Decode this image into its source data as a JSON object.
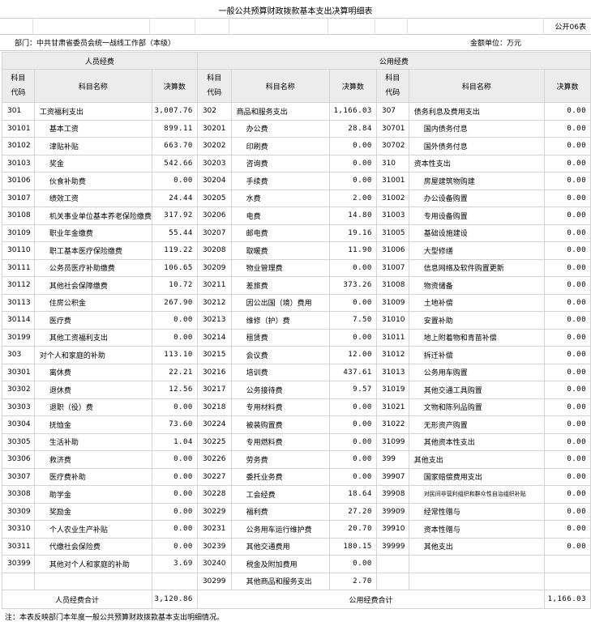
{
  "title": "一般公共预算财政拨款基本支出决算明细表",
  "form_code": "公开06表",
  "department": "部门：中共甘肃省委员会统一战线工作部（本级）",
  "unit": "金额单位：万元",
  "headers": {
    "personnel": "人员经费",
    "public": "公用经费",
    "code": "科目代码",
    "name": "科目名称",
    "amount": "决算数"
  },
  "rows": [
    [
      [
        "301",
        "工资福利支出",
        "3,007.76"
      ],
      [
        "302",
        "商品和服务支出",
        "1,166.03"
      ],
      [
        "307",
        "债务利息及费用支出",
        "0.00"
      ]
    ],
    [
      [
        "30101",
        "基本工资",
        "899.11"
      ],
      [
        "30201",
        "办公费",
        "28.84"
      ],
      [
        "30701",
        "国内债务付息",
        "0.00"
      ]
    ],
    [
      [
        "30102",
        "津贴补贴",
        "663.70"
      ],
      [
        "30202",
        "印刷费",
        "0.00"
      ],
      [
        "30702",
        "国外债务付息",
        "0.00"
      ]
    ],
    [
      [
        "30103",
        "奖金",
        "542.66"
      ],
      [
        "30203",
        "咨询费",
        "0.00"
      ],
      [
        "310",
        "资本性支出",
        "0.00"
      ]
    ],
    [
      [
        "30106",
        "伙食补助费",
        "0.00"
      ],
      [
        "30204",
        "手续费",
        "0.00"
      ],
      [
        "31001",
        "房屋建筑物购建",
        "0.00"
      ]
    ],
    [
      [
        "30107",
        "绩效工资",
        "24.44"
      ],
      [
        "30205",
        "水费",
        "2.00"
      ],
      [
        "31002",
        "办公设备购置",
        "0.00"
      ]
    ],
    [
      [
        "30108",
        "机关事业单位基本养老保险缴费",
        "317.92"
      ],
      [
        "30206",
        "电费",
        "14.80"
      ],
      [
        "31003",
        "专用设备购置",
        "0.00"
      ]
    ],
    [
      [
        "30109",
        "职业年金缴费",
        "55.44"
      ],
      [
        "30207",
        "邮电费",
        "19.16"
      ],
      [
        "31005",
        "基础设施建设",
        "0.00"
      ]
    ],
    [
      [
        "30110",
        "职工基本医疗保险缴费",
        "119.22"
      ],
      [
        "30208",
        "取暖费",
        "11.90"
      ],
      [
        "31006",
        "大型修缮",
        "0.00"
      ]
    ],
    [
      [
        "30111",
        "公务员医疗补助缴费",
        "106.65"
      ],
      [
        "30209",
        "物业管理费",
        "0.00"
      ],
      [
        "31007",
        "信息网络及软件购置更新",
        "0.00"
      ]
    ],
    [
      [
        "30112",
        "其他社会保障缴费",
        "10.72"
      ],
      [
        "30211",
        "差旅费",
        "373.26"
      ],
      [
        "31008",
        "物资储备",
        "0.00"
      ]
    ],
    [
      [
        "30113",
        "住房公积金",
        "267.90"
      ],
      [
        "30212",
        "因公出国（境）费用",
        "0.00"
      ],
      [
        "31009",
        "土地补偿",
        "0.00"
      ]
    ],
    [
      [
        "30114",
        "医疗费",
        "0.00"
      ],
      [
        "30213",
        "维修（护）费",
        "7.50"
      ],
      [
        "31010",
        "安置补助",
        "0.00"
      ]
    ],
    [
      [
        "30199",
        "其他工资福利支出",
        "0.00"
      ],
      [
        "30214",
        "租赁费",
        "0.00"
      ],
      [
        "31011",
        "地上附着物和青苗补偿",
        "0.00"
      ]
    ],
    [
      [
        "303",
        "对个人和家庭的补助",
        "113.10"
      ],
      [
        "30215",
        "会议费",
        "12.00"
      ],
      [
        "31012",
        "拆迁补偿",
        "0.00"
      ]
    ],
    [
      [
        "30301",
        "离休费",
        "22.21"
      ],
      [
        "30216",
        "培训费",
        "437.61"
      ],
      [
        "31013",
        "公务用车购置",
        "0.00"
      ]
    ],
    [
      [
        "30302",
        "退休费",
        "12.56"
      ],
      [
        "30217",
        "公务接待费",
        "9.57"
      ],
      [
        "31019",
        "其他交通工具购置",
        "0.00"
      ]
    ],
    [
      [
        "30303",
        "退职（役）费",
        "0.00"
      ],
      [
        "30218",
        "专用材料费",
        "0.00"
      ],
      [
        "31021",
        "文物和陈列品购置",
        "0.00"
      ]
    ],
    [
      [
        "30304",
        "抚恤金",
        "73.60"
      ],
      [
        "30224",
        "被装购置费",
        "0.00"
      ],
      [
        "31022",
        "无形资产购置",
        "0.00"
      ]
    ],
    [
      [
        "30305",
        "生活补助",
        "1.04"
      ],
      [
        "30225",
        "专用燃料费",
        "0.00"
      ],
      [
        "31099",
        "其他资本性支出",
        "0.00"
      ]
    ],
    [
      [
        "30306",
        "救济费",
        "0.00"
      ],
      [
        "30226",
        "劳务费",
        "0.00"
      ],
      [
        "399",
        "其他支出",
        "0.00"
      ]
    ],
    [
      [
        "30307",
        "医疗费补助",
        "0.00"
      ],
      [
        "30227",
        "委托业务费",
        "0.00"
      ],
      [
        "39907",
        "国家赔偿费用支出",
        "0.00"
      ]
    ],
    [
      [
        "30308",
        "助学金",
        "0.00"
      ],
      [
        "30228",
        "工会经费",
        "18.64"
      ],
      [
        "39908",
        "对民间非营利组织和群众性自治组织补贴",
        "0.00"
      ]
    ],
    [
      [
        "30309",
        "奖励金",
        "0.00"
      ],
      [
        "30229",
        "福利费",
        "27.20"
      ],
      [
        "39909",
        "经常性赠与",
        "0.00"
      ]
    ],
    [
      [
        "30310",
        "个人农业生产补贴",
        "0.00"
      ],
      [
        "30231",
        "公务用车运行维护费",
        "20.70"
      ],
      [
        "39910",
        "资本性赠与",
        "0.00"
      ]
    ],
    [
      [
        "30311",
        "代缴社会保险费",
        "0.00"
      ],
      [
        "30239",
        "其他交通费用",
        "180.15"
      ],
      [
        "39999",
        "其他支出",
        "0.00"
      ]
    ],
    [
      [
        "30399",
        "其他对个人和家庭的补助",
        "3.69"
      ],
      [
        "30240",
        "税金及附加费用",
        "0.00"
      ],
      [
        "",
        "",
        " "
      ]
    ],
    [
      [
        "",
        "",
        ""
      ],
      [
        "30299",
        "其他商品和服务支出",
        "2.70"
      ],
      [
        "",
        "",
        ""
      ]
    ]
  ],
  "totals": {
    "personnel_label": "人员经费合计",
    "personnel_value": "3,120.86",
    "public_label": "公用经费合计",
    "public_value": "1,166.03"
  },
  "note": "注：本表反映部门本年度一般公共预算财政拨款基本支出明细情况。"
}
